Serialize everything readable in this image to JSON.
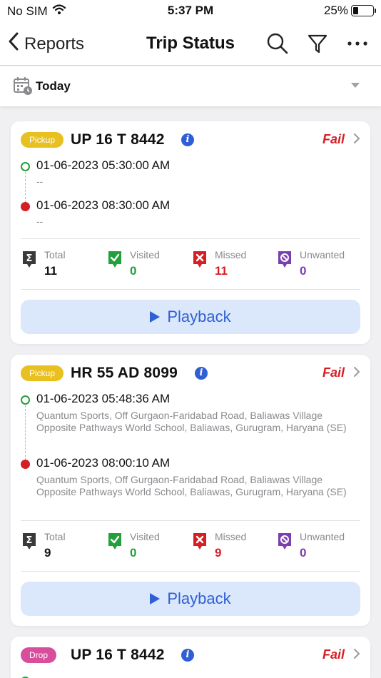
{
  "status_bar": {
    "carrier": "No SIM",
    "time": "5:37 PM",
    "battery": "25%",
    "battery_level": 0.25
  },
  "nav": {
    "back_label": "Reports",
    "title": "Trip Status"
  },
  "date_filter": {
    "label": "Today"
  },
  "trips": [
    {
      "type": "Pickup",
      "plate": "UP 16 T 8442",
      "status": "Fail",
      "start_time": "01-06-2023 05:30:00 AM",
      "start_address": "--",
      "end_time": "01-06-2023 08:30:00 AM",
      "end_address": "--",
      "stats": {
        "total_label": "Total",
        "total": "11",
        "visited_label": "Visited",
        "visited": "0",
        "missed_label": "Missed",
        "missed": "11",
        "unwanted_label": "Unwanted",
        "unwanted": "0"
      },
      "playback_label": "Playback"
    },
    {
      "type": "Pickup",
      "plate": "HR 55 AD 8099",
      "status": "Fail",
      "start_time": "01-06-2023 05:48:36 AM",
      "start_address": "Quantum Sports, Off Gurgaon-Faridabad Road, Baliawas Village Opposite Pathways World School, Baliawas, Gurugram, Haryana (SE)",
      "end_time": "01-06-2023 08:00:10 AM",
      "end_address": "Quantum Sports, Off Gurgaon-Faridabad Road, Baliawas Village Opposite Pathways World School, Baliawas, Gurugram, Haryana (SE)",
      "stats": {
        "total_label": "Total",
        "total": "9",
        "visited_label": "Visited",
        "visited": "0",
        "missed_label": "Missed",
        "missed": "9",
        "unwanted_label": "Unwanted",
        "unwanted": "0"
      },
      "playback_label": "Playback"
    },
    {
      "type": "Drop",
      "plate": "UP 16 T 8442",
      "status": "Fail"
    }
  ],
  "colors": {
    "fail": "#d41f25",
    "pickup_badge": "#e8c020",
    "drop_badge": "#d94e9c",
    "visited": "#22a03a",
    "missed": "#d41f25",
    "unwanted": "#7b3fb0",
    "accent": "#2f5fd4"
  }
}
